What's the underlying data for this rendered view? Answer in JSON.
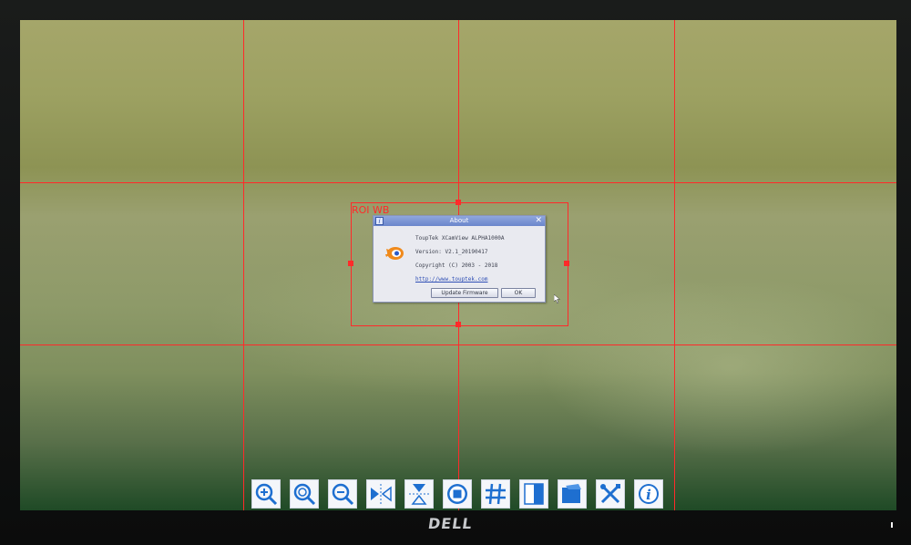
{
  "monitor": {
    "brand": "DELL"
  },
  "overlay": {
    "roi_label": "ROI WB"
  },
  "about_dialog": {
    "title": "About",
    "close_glyph": "✕",
    "info_glyph": "i",
    "product": "ToupTek XCamView ALPHA1000A",
    "version": "Version: V2.1_20190417",
    "copyright": "Copyright (C) 2003 - 2018",
    "link": "http://www.touptek.com",
    "update_button": "Update Firmware",
    "ok_button": "OK"
  },
  "toolbar": {
    "items": [
      {
        "name": "zoom-in-icon"
      },
      {
        "name": "zoom-fit-icon"
      },
      {
        "name": "zoom-out-icon"
      },
      {
        "name": "flip-horizontal-icon"
      },
      {
        "name": "flip-vertical-icon"
      },
      {
        "name": "stop-record-icon"
      },
      {
        "name": "grid-icon"
      },
      {
        "name": "compare-split-icon"
      },
      {
        "name": "folder-icon"
      },
      {
        "name": "tools-icon"
      },
      {
        "name": "info-icon"
      }
    ]
  },
  "colors": {
    "overlay_red": "#ff2a2a",
    "icon_blue": "#1e6fd0",
    "dialog_title": "#7b93d4"
  }
}
